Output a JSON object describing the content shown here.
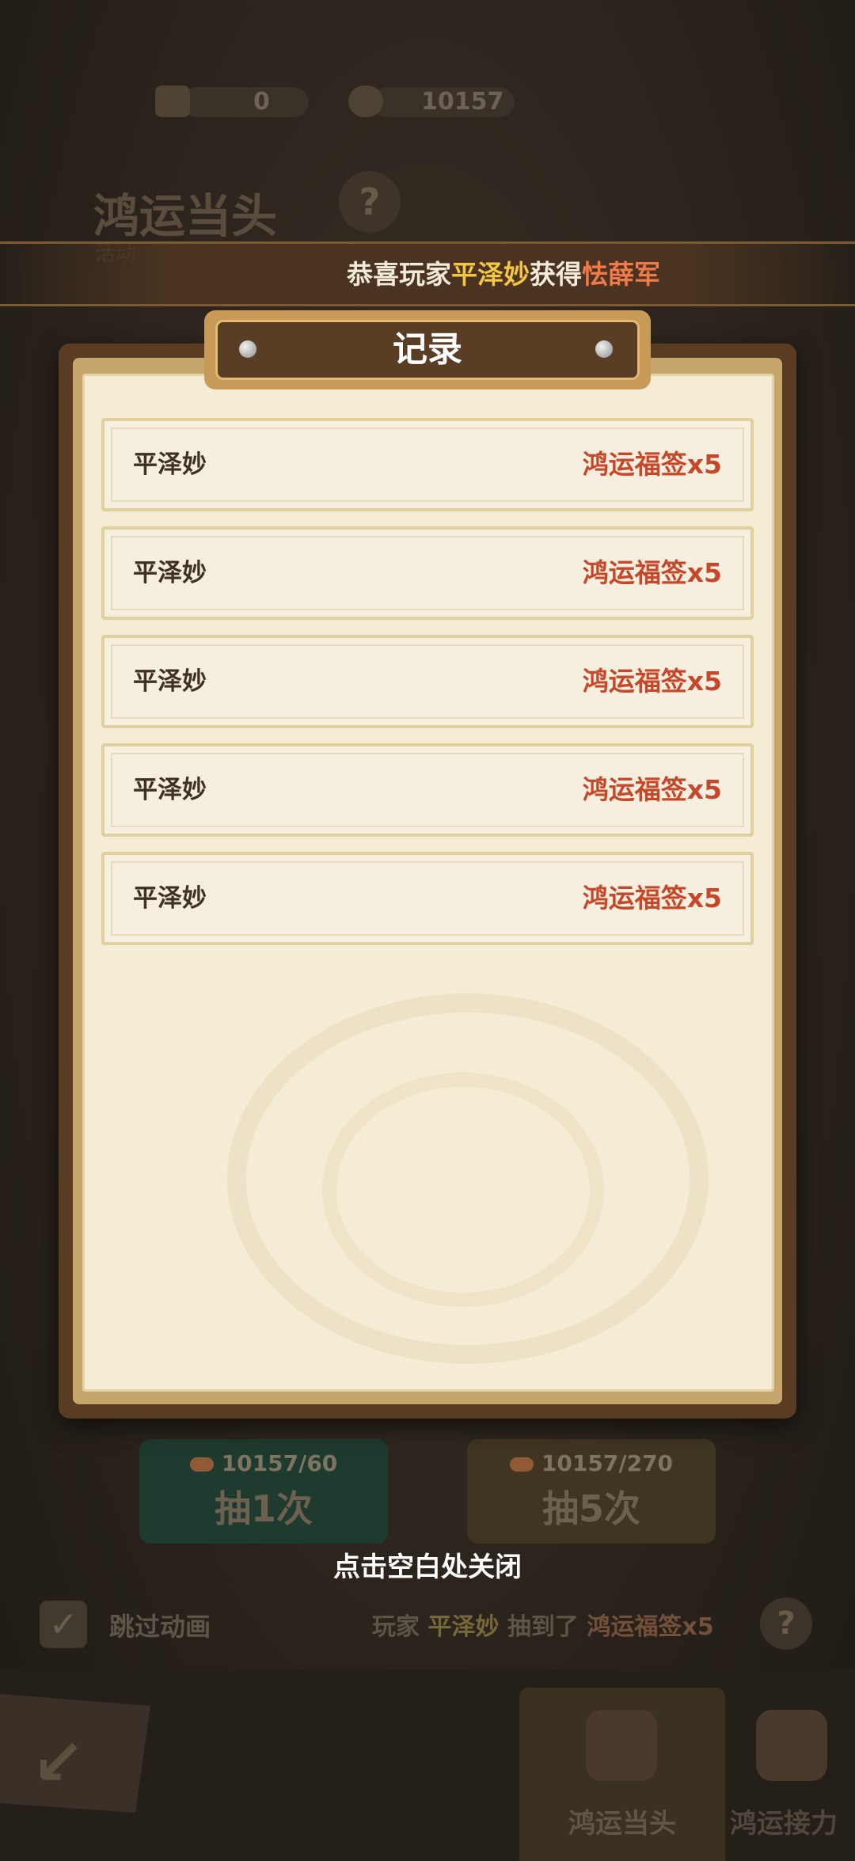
{
  "header": {
    "currency_a": "0",
    "currency_b": "10157",
    "title": "鸿运当头",
    "subtitle": "活动"
  },
  "marquee": {
    "prefix": "恭喜玩家",
    "player": "平泽妙",
    "middle": "获得",
    "item": "怯薛军"
  },
  "modal": {
    "title": "记录",
    "records": [
      {
        "name": "平泽妙",
        "reward": "鸿运福签x5"
      },
      {
        "name": "平泽妙",
        "reward": "鸿运福签x5"
      },
      {
        "name": "平泽妙",
        "reward": "鸿运福签x5"
      },
      {
        "name": "平泽妙",
        "reward": "鸿运福签x5"
      },
      {
        "name": "平泽妙",
        "reward": "鸿运福签x5"
      }
    ],
    "close_hint": "点击空白处关闭"
  },
  "draw": {
    "one_cost": "10157/60",
    "one_label": "抽1次",
    "five_cost": "10157/270",
    "five_label": "抽5次"
  },
  "footer": {
    "skip_label": "跳过动画",
    "result_prefix": "玩家",
    "result_player": "平泽妙",
    "result_middle": "抽到了",
    "result_item": "鸿运福签x5",
    "tab_active": "鸿运当头",
    "tab_other": "鸿运接力"
  },
  "colors": {
    "reward_text": "#c5482a",
    "marquee_player": "#f5c644",
    "marquee_item": "#f07b4a"
  }
}
